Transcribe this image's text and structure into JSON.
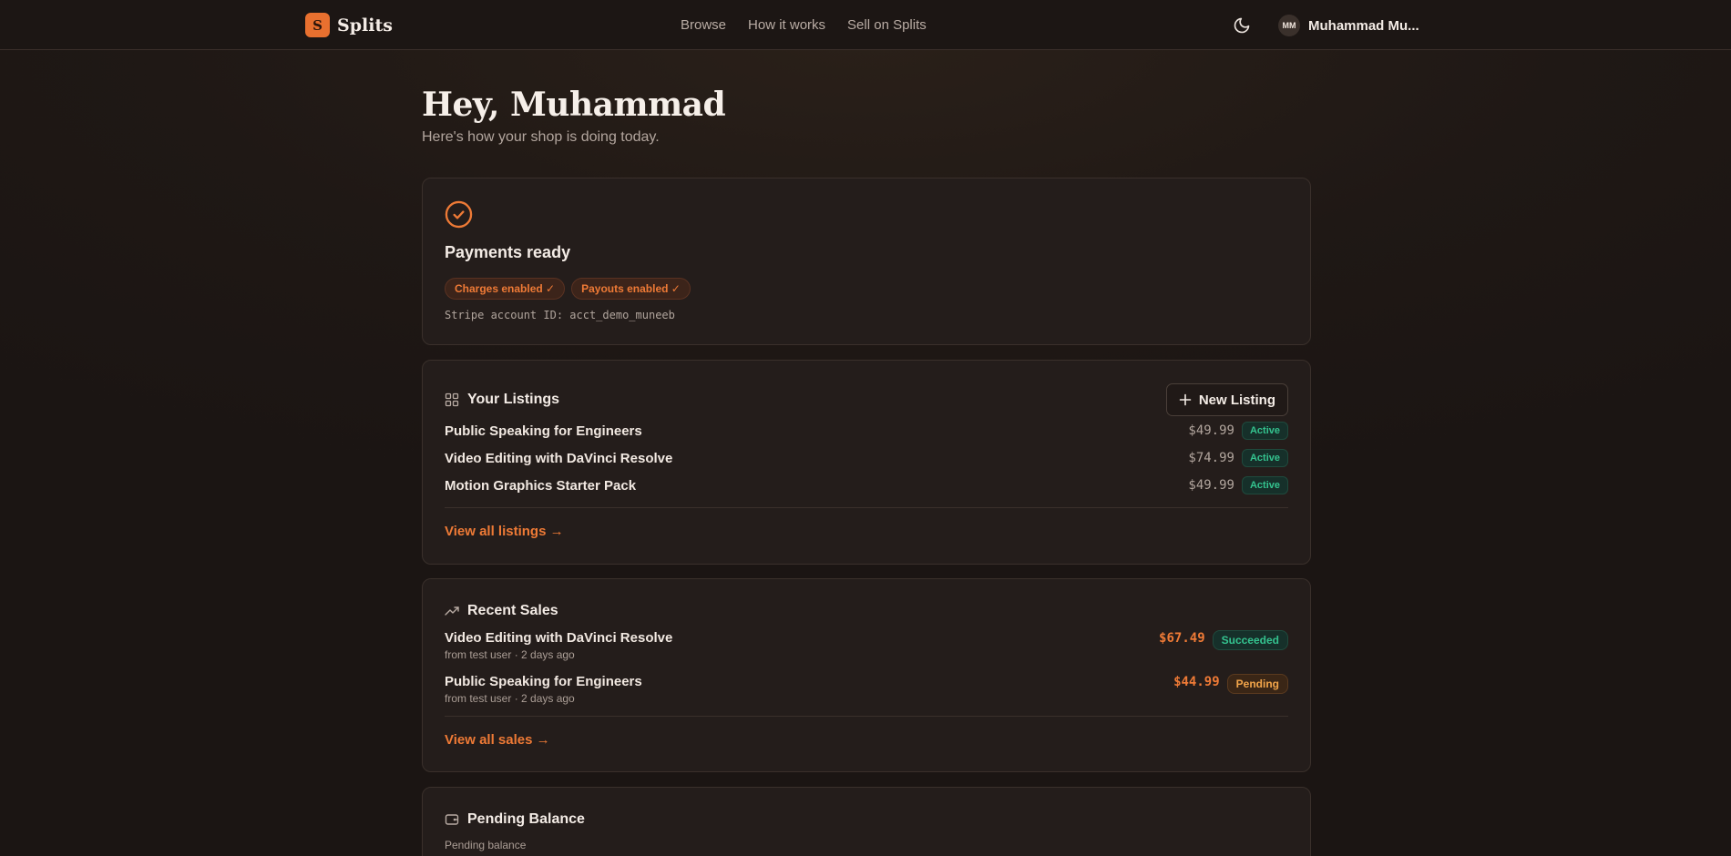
{
  "header": {
    "logo_letter": "S",
    "brand": "Splits",
    "nav": [
      "Browse",
      "How it works",
      "Sell on Splits"
    ],
    "theme_icon": "moon-icon",
    "user_initials": "MM",
    "user_name": "Muhammad Mu..."
  },
  "greeting": {
    "title": "Hey, Muhammad",
    "subtitle": "Here's how your shop is doing today."
  },
  "payments": {
    "icon": "check-circle-icon",
    "title": "Payments ready",
    "pills": [
      "Charges enabled ✓",
      "Payouts enabled ✓"
    ],
    "account": "Stripe account ID: acct_demo_muneeb"
  },
  "listings": {
    "icon": "grid-icon",
    "title": "Your Listings",
    "new_button": "New Listing",
    "items": [
      {
        "title": "Public Speaking for Engineers",
        "price": "$49.99",
        "status": "Active"
      },
      {
        "title": "Video Editing with DaVinci Resolve",
        "price": "$74.99",
        "status": "Active"
      },
      {
        "title": "Motion Graphics Starter Pack",
        "price": "$49.99",
        "status": "Active"
      }
    ],
    "view_all": "View all listings →"
  },
  "sales": {
    "icon": "trending-up-icon",
    "title": "Recent Sales",
    "items": [
      {
        "title": "Video Editing with DaVinci Resolve",
        "meta": "from test user · 2 days ago",
        "amount": "$67.49",
        "status": "Succeeded"
      },
      {
        "title": "Public Speaking for Engineers",
        "meta": "from test user · 2 days ago",
        "amount": "$44.99",
        "status": "Pending"
      }
    ],
    "view_all": "View all sales →"
  },
  "balance": {
    "icon": "wallet-icon",
    "title": "Pending Balance",
    "label": "Pending balance"
  },
  "colors": {
    "accent": "#ee7a36",
    "success": "#34c38f",
    "pending": "#f2a54a",
    "background": "#1d1715",
    "card": "#241d1b"
  }
}
